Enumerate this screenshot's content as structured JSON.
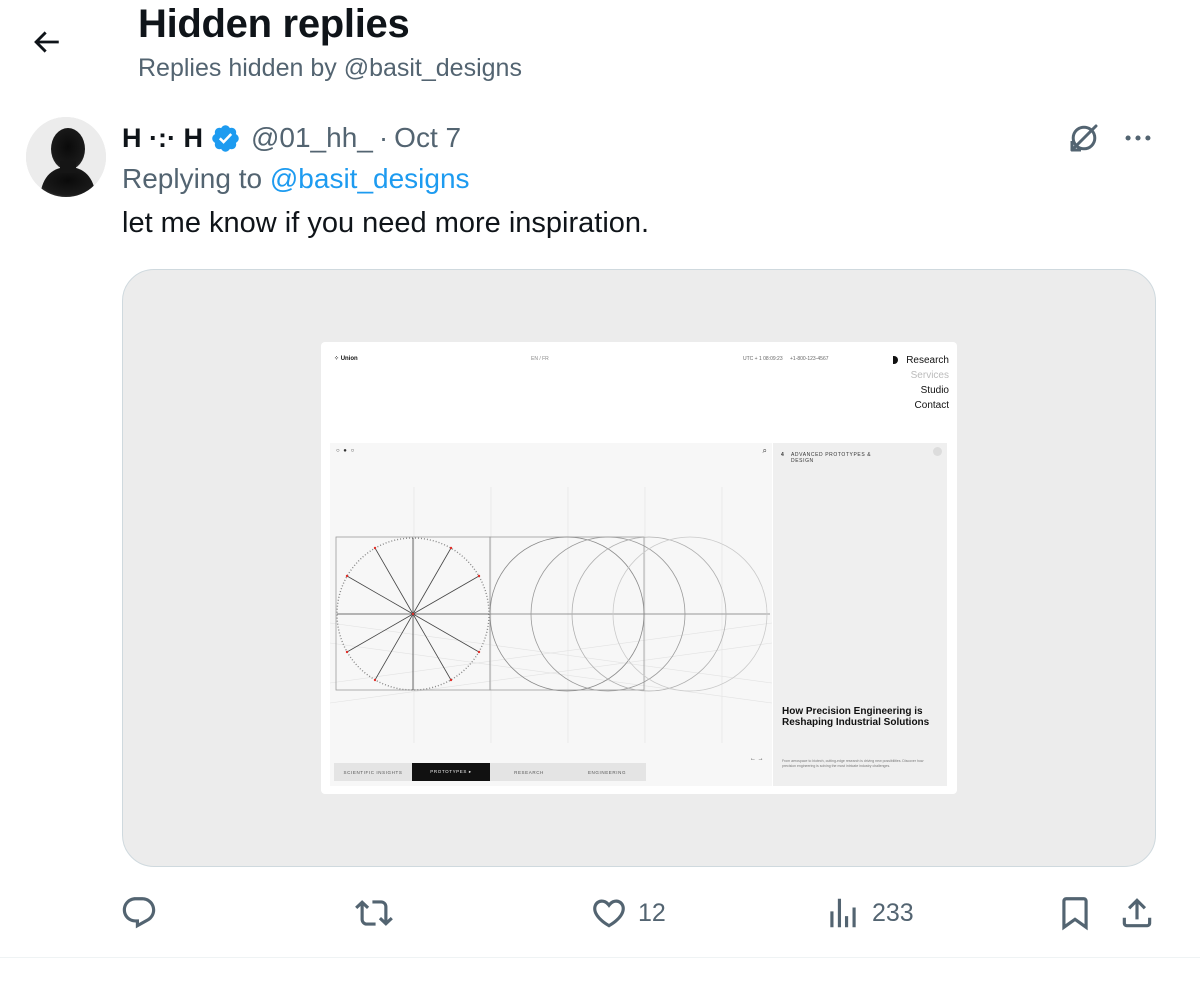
{
  "header": {
    "title": "Hidden replies",
    "subtitle": "Replies hidden by @basit_designs"
  },
  "post": {
    "author_name": "H ·:· H",
    "author_handle": "@01_hh_",
    "separator": "·",
    "date": "Oct 7",
    "replying_prefix": "Replying to",
    "replying_to": "@basit_designs",
    "text": "let me know if you need more inspiration.",
    "icons": {
      "back": "arrow-left-icon",
      "verified": "verified-badge-icon",
      "unhide": "unhide-icon",
      "more": "more-options-icon"
    }
  },
  "media": {
    "logo": "⁘ Union",
    "lang": "EN / FR",
    "utc": "UTC + 1 08:09:23",
    "phone": "+1-800-123-4567",
    "nav": [
      "Research",
      "Services",
      "Studio",
      "Contact"
    ],
    "pager": "○ ● ○",
    "side_label_index": "4",
    "side_label": "ADVANCED PROTOTYPES & DESIGN",
    "headline": "How Precision Engineering is Reshaping Industrial Solutions",
    "body": "From aerospace to biotech, cutting-edge research is driving new possibilities. Discover how precision engineering is solving the most intricate industry challenges.",
    "tabs": [
      "SCIENTIFIC INSIGHTS",
      "PROTOTYPES ▸",
      "RESEARCH",
      "ENGINEERING"
    ],
    "arrows": "← →"
  },
  "actions": {
    "reply": {
      "icon": "reply-icon",
      "count": ""
    },
    "repost": {
      "icon": "repost-icon",
      "count": ""
    },
    "like": {
      "icon": "heart-icon",
      "count": "12"
    },
    "views": {
      "icon": "views-icon",
      "count": "233"
    },
    "bookmark": {
      "icon": "bookmark-icon"
    },
    "share": {
      "icon": "share-icon"
    }
  },
  "colors": {
    "text_primary": "#0f1419",
    "text_secondary": "#536471",
    "link": "#1d9bf0",
    "verified": "#1d9bf0"
  }
}
